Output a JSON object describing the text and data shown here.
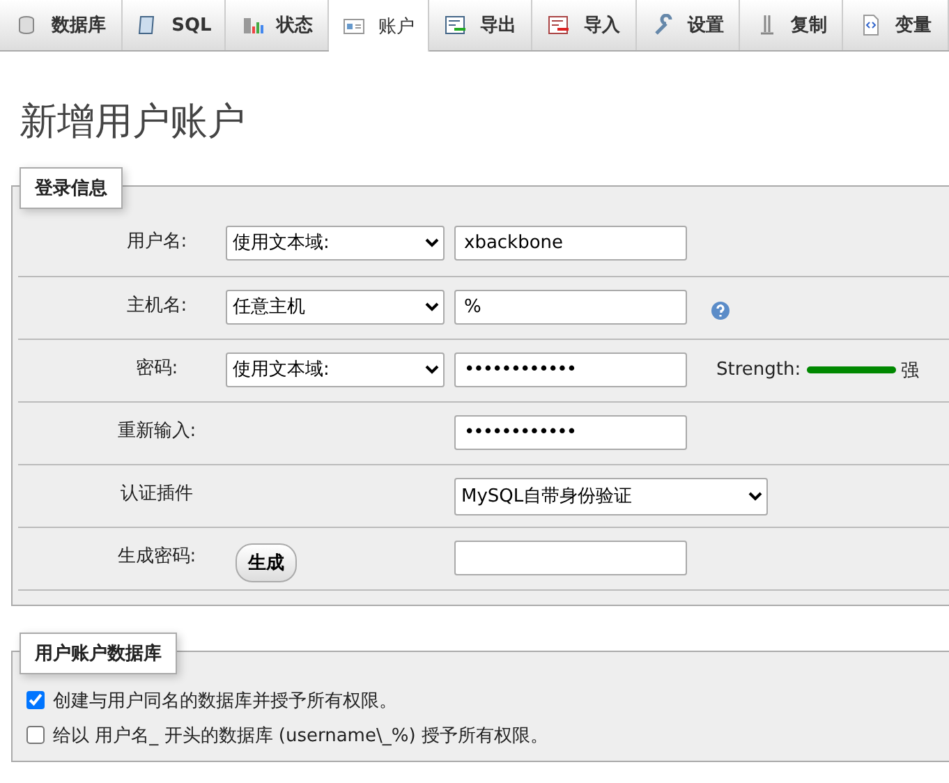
{
  "tabs": [
    {
      "label": "数据库",
      "selected": false
    },
    {
      "label": "SQL",
      "selected": false
    },
    {
      "label": "状态",
      "selected": false
    },
    {
      "label": "账户",
      "selected": true
    },
    {
      "label": "导出",
      "selected": false
    },
    {
      "label": "导入",
      "selected": false
    },
    {
      "label": "设置",
      "selected": false
    },
    {
      "label": "复制",
      "selected": false
    },
    {
      "label": "变量",
      "selected": false
    }
  ],
  "page_title": "新增用户账户",
  "login_info": {
    "legend": "登录信息",
    "rows": [
      {
        "label": "用户名:",
        "select": "使用文本域:",
        "input": {
          "value": "xbackbone",
          "kind": "text"
        }
      },
      {
        "label": "主机名:",
        "select": "任意主机",
        "input": {
          "value": "%",
          "kind": "text"
        },
        "help": true
      },
      {
        "label": "密码:",
        "select": "使用文本域:",
        "input": {
          "value": "••••••••••••",
          "kind": "password"
        },
        "strength": {
          "label": "Strength:",
          "level": 1,
          "text": "强"
        }
      },
      {
        "label": "重新输入:",
        "input": {
          "value": "••••••••••••",
          "kind": "password"
        }
      },
      {
        "label": "认证插件",
        "plugin": "MySQL自带身份验证"
      },
      {
        "label": "生成密码:",
        "button": "生成",
        "input": {
          "kind": "text"
        }
      }
    ]
  },
  "user_database": {
    "legend": "用户账户数据库",
    "options": [
      {
        "label": "创建与用户同名的数据库并授予所有权限。",
        "checked": true
      },
      {
        "label": "给以 用户名_ 开头的数据库 (username\\_%) 授予所有权限。",
        "checked": false
      }
    ]
  }
}
